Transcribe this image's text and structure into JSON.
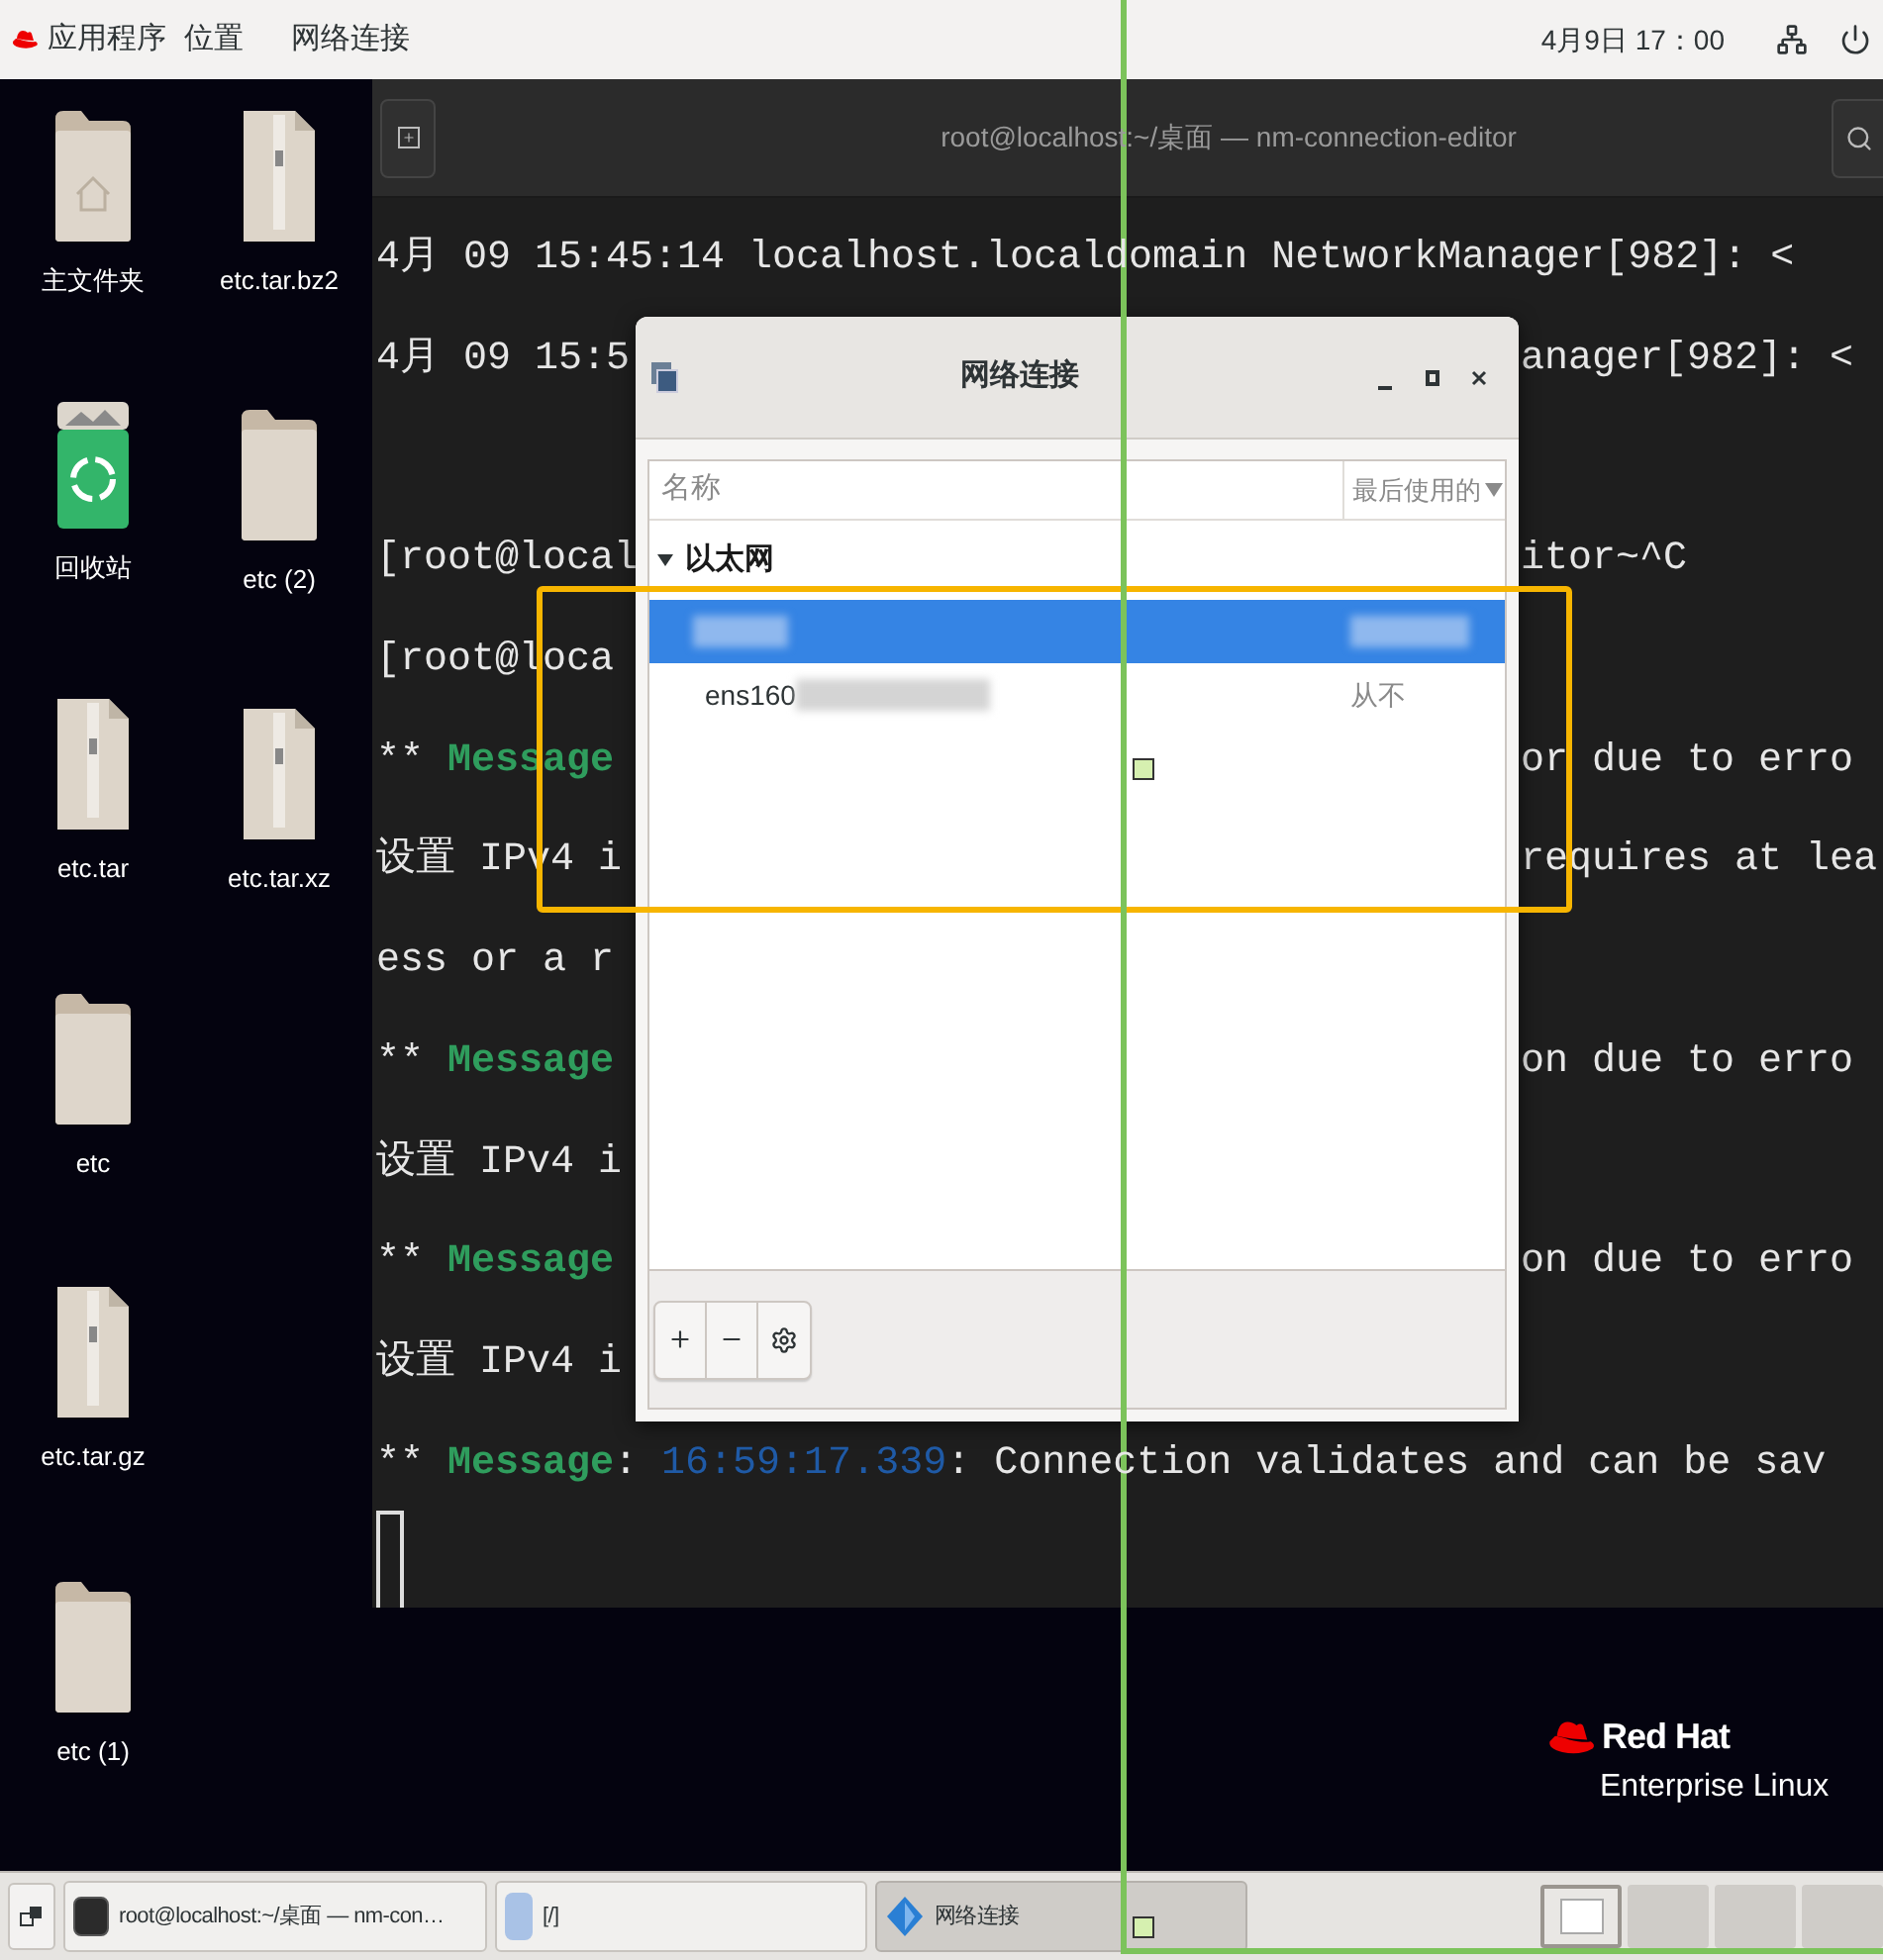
{
  "top_bar": {
    "menus": [
      "应用程序",
      "位置",
      "网络连接"
    ],
    "clock": "4月9日 17：00"
  },
  "desktop": {
    "columns": [
      [
        {
          "label": "主文件夹",
          "kind": "home"
        },
        {
          "label": "回收站",
          "kind": "trash"
        },
        {
          "label": "etc.tar",
          "kind": "archive"
        },
        {
          "label": "etc",
          "kind": "folder"
        },
        {
          "label": "etc.tar.gz",
          "kind": "archive"
        },
        {
          "label": "etc (1)",
          "kind": "folder"
        }
      ],
      [
        {
          "label": "etc.tar.bz2",
          "kind": "archive"
        },
        {
          "label": "etc (2)",
          "kind": "folder"
        },
        {
          "label": "etc.tar.xz",
          "kind": "archive"
        }
      ]
    ]
  },
  "terminal": {
    "title": "root@localhost:~/桌面 — nm-connection-editor",
    "lines": [
      {
        "kind": "full",
        "left": [
          {
            "text": "4月 09 15:45:14 localhost.localdomain NetworkManager[982]: <",
            "kind": "plain"
          }
        ]
      },
      {
        "kind": "split",
        "left": [
          {
            "text": "4月 09 15:5",
            "kind": "plain"
          }
        ],
        "right": [
          {
            "text": "anager[982]: <",
            "kind": "plain"
          }
        ]
      },
      {
        "kind": "blank"
      },
      {
        "kind": "split",
        "left": [
          {
            "text": "[root@local",
            "kind": "plain"
          }
        ],
        "right": [
          {
            "text": "itor~^C",
            "kind": "plain"
          }
        ]
      },
      {
        "kind": "split",
        "left": [
          {
            "text": "[root@loca",
            "kind": "plain"
          }
        ]
      },
      {
        "kind": "split",
        "left": [
          {
            "text": "** ",
            "kind": "plain"
          },
          {
            "text": "Message",
            "kind": "keyword"
          }
        ],
        "right": [
          {
            "text": "or due to erro",
            "kind": "plain"
          }
        ]
      },
      {
        "kind": "split",
        "left": [
          {
            "text": "设置 IPv4 i",
            "kind": "plain"
          }
        ],
        "right": [
          {
            "text": "requires at lea",
            "kind": "plain"
          }
        ]
      },
      {
        "kind": "split",
        "left": [
          {
            "text": "ess or a r",
            "kind": "plain"
          }
        ]
      },
      {
        "kind": "split",
        "left": [
          {
            "text": "** ",
            "kind": "plain"
          },
          {
            "text": "Message",
            "kind": "keyword"
          }
        ],
        "right": [
          {
            "text": "on due to erro",
            "kind": "plain"
          }
        ]
      },
      {
        "kind": "split",
        "left": [
          {
            "text": "设置 IPv4 i",
            "kind": "plain"
          }
        ]
      },
      {
        "kind": "split",
        "left": [
          {
            "text": "** ",
            "kind": "plain"
          },
          {
            "text": "Message",
            "kind": "keyword"
          }
        ],
        "right": [
          {
            "text": "on due to erro",
            "kind": "plain"
          }
        ]
      },
      {
        "kind": "split",
        "left": [
          {
            "text": "设置 IPv4 i",
            "kind": "plain"
          }
        ]
      },
      {
        "kind": "full",
        "left": [
          {
            "text": "** ",
            "kind": "plain"
          },
          {
            "text": "Message",
            "kind": "keyword"
          },
          {
            "text": ": ",
            "kind": "plain"
          },
          {
            "text": "16:59:17.339",
            "kind": "time"
          },
          {
            "text": ": Connection validates and can be sav",
            "kind": "plain"
          }
        ]
      }
    ]
  },
  "dialog": {
    "title": "网络连接",
    "columns": [
      "名称",
      "最后使用的"
    ],
    "group": {
      "label": "以太网",
      "expanded": true,
      "rows": [
        {
          "selected": true,
          "redacted": true
        },
        {
          "name": "ens160",
          "last_used": "从不",
          "selected": false,
          "redacted": true
        }
      ]
    }
  },
  "logo": {
    "brand": "Red Hat",
    "product": "Enterprise Linux"
  },
  "taskbar": {
    "tasks": [
      {
        "label": "root@localhost:~/桌面 — nm-con…",
        "kind": "terminal",
        "selected": false
      },
      {
        "label": "[/]",
        "kind": "files",
        "selected": false
      },
      {
        "label": "网络连接",
        "kind": "network",
        "selected": true
      }
    ],
    "workspaces": [
      {
        "selected": true
      },
      {
        "selected": false
      },
      {
        "selected": false
      },
      {
        "selected": false
      }
    ]
  }
}
